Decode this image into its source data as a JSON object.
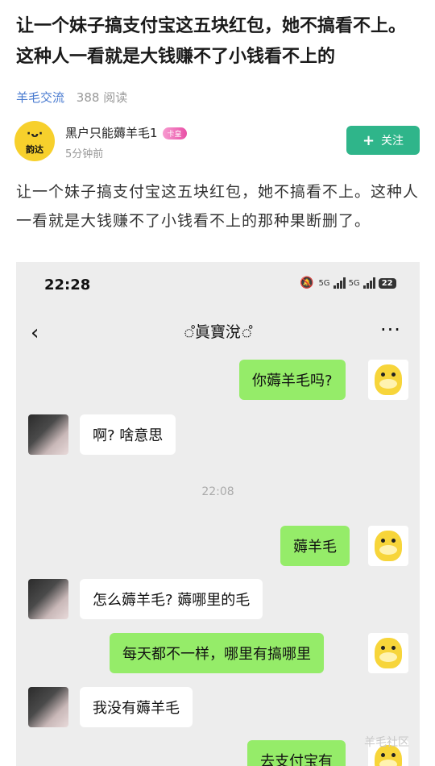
{
  "post": {
    "title": "让一个妹子搞支付宝这五块红包，她不搞看不上。这种人一看就是大钱赚不了小钱看不上的",
    "category": "羊毛交流",
    "reads": "388 阅读",
    "author": {
      "name": "黑户只能薅羊毛1",
      "badge": "卡皇",
      "time": "5分钟前",
      "avatar_face": "·ᴗ·",
      "avatar_text": "韵达"
    },
    "follow_label": "关注",
    "body": "让一个妹子搞支付宝这五块红包，她不搞看不上。这种人一看就是大钱赚不了小钱看不上的那种果断删了。"
  },
  "screenshot": {
    "status_time": "22:28",
    "signal": "5G",
    "battery": "22",
    "chat_title": "ஂ眞寶涗ஂ",
    "timestamp": "22:08",
    "messages": [
      {
        "side": "right",
        "text": "你薅羊毛吗?"
      },
      {
        "side": "left",
        "text": "啊? 啥意思"
      },
      {
        "side": "right",
        "text": "薅羊毛"
      },
      {
        "side": "left",
        "text": "怎么薅羊毛? 薅哪里的毛"
      },
      {
        "side": "right",
        "text": "每天都不一样，哪里有搞哪里"
      },
      {
        "side": "left",
        "text": "我没有薅羊毛"
      },
      {
        "side": "right",
        "text": "去支付宝有"
      }
    ]
  },
  "watermark": "羊毛社区",
  "colors": {
    "accent": "#2fb58a",
    "link": "#4a7bd0",
    "bubble_green": "#95ec69"
  }
}
